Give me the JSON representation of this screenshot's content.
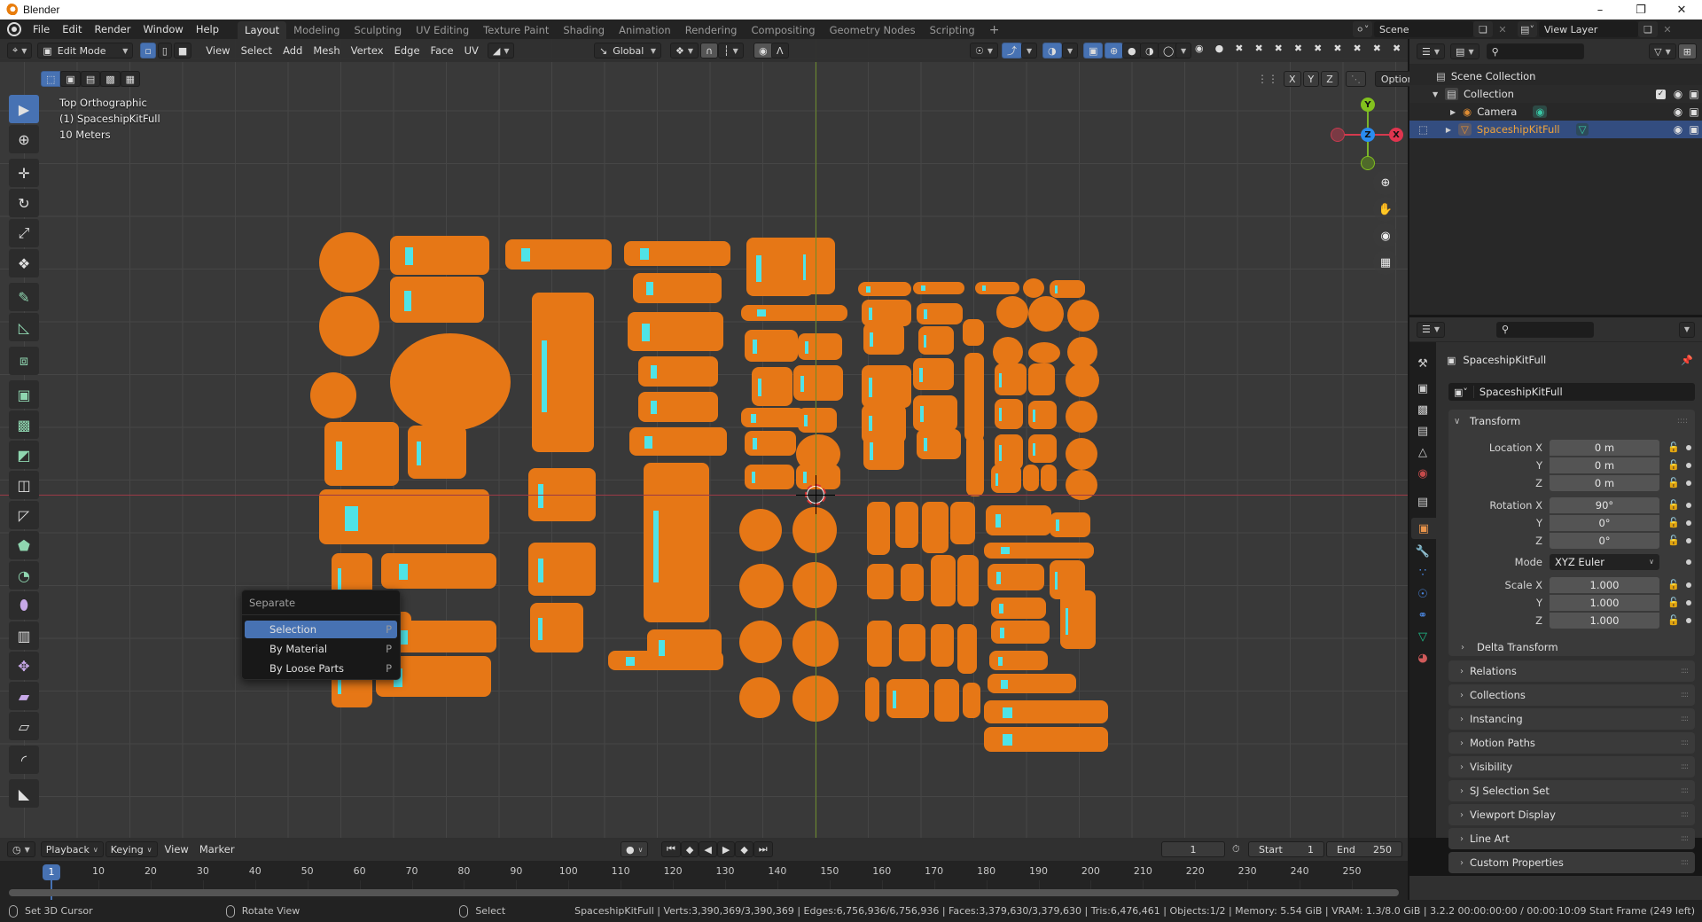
{
  "window": {
    "title": "Blender",
    "controls": [
      "minimize",
      "maximize",
      "close"
    ],
    "control_glyphs": [
      "–",
      "❐",
      "✕"
    ]
  },
  "topbar": {
    "menus": [
      "File",
      "Edit",
      "Render",
      "Window",
      "Help"
    ],
    "workspaces": [
      "Layout",
      "Modeling",
      "Sculpting",
      "UV Editing",
      "Texture Paint",
      "Shading",
      "Animation",
      "Rendering",
      "Compositing",
      "Geometry Nodes",
      "Scripting"
    ],
    "active_workspace": "Layout",
    "add_workspace": "+",
    "scene": "Scene",
    "view_layer": "View Layer"
  },
  "viewport_header": {
    "mode": "Edit Mode",
    "menus": [
      "View",
      "Select",
      "Add",
      "Mesh",
      "Vertex",
      "Edge",
      "Face",
      "UV"
    ],
    "transform_orientation": "Global",
    "options_label": "Options",
    "mirror_axes": [
      "X",
      "Y",
      "Z"
    ]
  },
  "viewport": {
    "view_name": "Top Orthographic",
    "object_info": "(1) SpaceshipKitFull",
    "scale_info": "10 Meters",
    "gizmo_axes": {
      "x": "X",
      "y": "Y",
      "z": "Z"
    },
    "colors": {
      "background": "#393939",
      "grid": "#464646",
      "x_axis": "#9a3a46",
      "y_axis": "#6a8a2a",
      "selection_orange": "#e67716",
      "edge_cyan": "#4fe3e6"
    }
  },
  "separate_menu": {
    "title": "Separate",
    "items": [
      {
        "label": "Selection",
        "shortcut": "P",
        "highlighted": true
      },
      {
        "label": "By Material",
        "shortcut": "P",
        "highlighted": false
      },
      {
        "label": "By Loose Parts",
        "shortcut": "P",
        "highlighted": false
      }
    ]
  },
  "toolbar": {
    "tools": [
      "select-box",
      "cursor",
      "move",
      "rotate",
      "scale",
      "transform",
      "annotate",
      "measure",
      "add-cube",
      "extrude-region",
      "inset-faces",
      "bevel",
      "loop-cut",
      "knife",
      "poly-build",
      "spin",
      "smooth",
      "edge-slide",
      "shrink-fatten",
      "shear",
      "rip-region",
      "to-sphere",
      "shade-smooth"
    ],
    "active_tool": "select-box"
  },
  "outliner": {
    "rows": [
      {
        "label": "Scene Collection",
        "level": 0
      },
      {
        "label": "Collection",
        "level": 1
      },
      {
        "label": "Camera",
        "level": 2
      },
      {
        "label": "SpaceshipKitFull",
        "level": 2,
        "selected": true
      }
    ]
  },
  "properties": {
    "object_name": "SpaceshipKitFull",
    "object_name_field": "SpaceshipKitFull",
    "transform_title": "Transform",
    "location": {
      "label": "Location X",
      "x": "0 m",
      "y": "0 m",
      "z": "0 m"
    },
    "rotation": {
      "label": "Rotation X",
      "x": "90°",
      "y": "0°",
      "z": "0°"
    },
    "mode_label": "Mode",
    "mode_value": "XYZ Euler",
    "scale": {
      "label": "Scale X",
      "x": "1.000",
      "y": "1.000",
      "z": "1.000"
    },
    "axis_labels": [
      "Y",
      "Z"
    ],
    "delta_transform": "Delta Transform",
    "panels": [
      "Relations",
      "Collections",
      "Instancing",
      "Motion Paths",
      "Visibility",
      "SJ Selection Set",
      "Viewport Display",
      "Line Art",
      "Custom Properties"
    ]
  },
  "timeline": {
    "menus": [
      "Playback",
      "Keying",
      "View",
      "Marker"
    ],
    "current_frame": "1",
    "start_label": "Start",
    "start": "1",
    "end_label": "End",
    "end": "250",
    "ticks": [
      "10",
      "20",
      "30",
      "40",
      "50",
      "60",
      "70",
      "80",
      "90",
      "100",
      "110",
      "120",
      "130",
      "140",
      "150",
      "160",
      "170",
      "180",
      "190",
      "200",
      "210",
      "220",
      "230",
      "240",
      "250"
    ],
    "playhead_label": "1"
  },
  "statusbar": {
    "hints": [
      "Set 3D Cursor",
      "Rotate View",
      "Select"
    ],
    "stats": "SpaceshipKitFull | Verts:3,390,369/3,390,369 | Edges:6,756,936/6,756,936 | Faces:3,379,630/3,379,630 | Tris:6,476,461 | Objects:1/2 | Memory: 5.54 GiB | VRAM: 1.3/8.0 GiB | 3.2.2  00:00:00:00 / 00:00:10:09  Start Frame (249 left)"
  }
}
